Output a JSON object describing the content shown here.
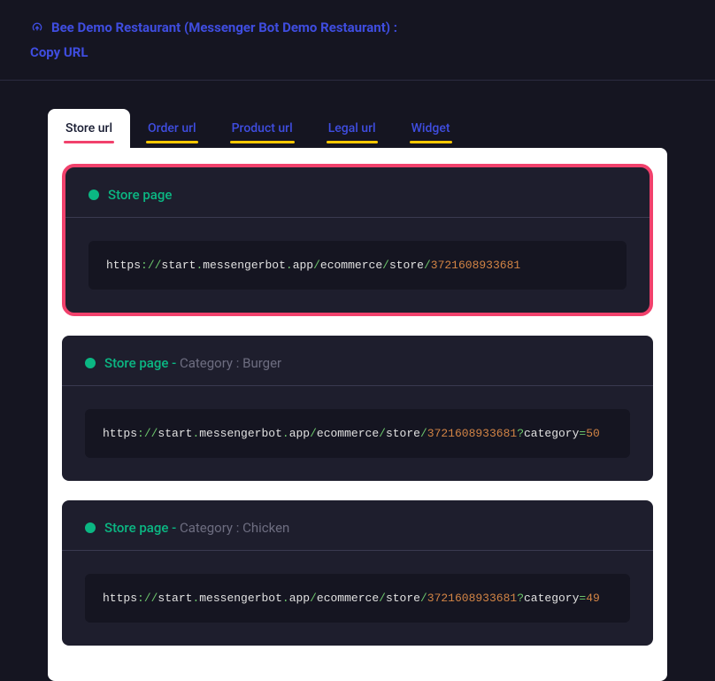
{
  "header": {
    "title": "Bee Demo Restaurant (Messenger Bot Demo Restaurant) :",
    "subtitle": "Copy URL"
  },
  "tabs": [
    {
      "label": "Store url",
      "active": true
    },
    {
      "label": "Order url",
      "active": false
    },
    {
      "label": "Product url",
      "active": false
    },
    {
      "label": "Legal url",
      "active": false
    },
    {
      "label": "Widget",
      "active": false
    }
  ],
  "cards": [
    {
      "highlighted": true,
      "title_main": "Store page",
      "title_sub": "",
      "url_tokens": [
        {
          "t": "https",
          "c": "white"
        },
        {
          "t": "://",
          "c": "green"
        },
        {
          "t": "start",
          "c": "white"
        },
        {
          "t": ".",
          "c": "green"
        },
        {
          "t": "messengerbot",
          "c": "white"
        },
        {
          "t": ".",
          "c": "green"
        },
        {
          "t": "app",
          "c": "white"
        },
        {
          "t": "/",
          "c": "green"
        },
        {
          "t": "ecommerce",
          "c": "white"
        },
        {
          "t": "/",
          "c": "green"
        },
        {
          "t": "store",
          "c": "white"
        },
        {
          "t": "/",
          "c": "green"
        },
        {
          "t": "3721608933681",
          "c": "orange"
        }
      ]
    },
    {
      "highlighted": false,
      "title_main": "Store page - ",
      "title_sub": "Category : Burger",
      "url_tokens": [
        {
          "t": "https",
          "c": "white"
        },
        {
          "t": "://",
          "c": "green"
        },
        {
          "t": "start",
          "c": "white"
        },
        {
          "t": ".",
          "c": "green"
        },
        {
          "t": "messengerbot",
          "c": "white"
        },
        {
          "t": ".",
          "c": "green"
        },
        {
          "t": "app",
          "c": "white"
        },
        {
          "t": "/",
          "c": "green"
        },
        {
          "t": "ecommerce",
          "c": "white"
        },
        {
          "t": "/",
          "c": "green"
        },
        {
          "t": "store",
          "c": "white"
        },
        {
          "t": "/",
          "c": "green"
        },
        {
          "t": "3721608933681",
          "c": "orange"
        },
        {
          "t": "?",
          "c": "green"
        },
        {
          "t": "category",
          "c": "white"
        },
        {
          "t": "=",
          "c": "green"
        },
        {
          "t": "50",
          "c": "orange"
        }
      ]
    },
    {
      "highlighted": false,
      "title_main": "Store page - ",
      "title_sub": "Category : Chicken",
      "url_tokens": [
        {
          "t": "https",
          "c": "white"
        },
        {
          "t": "://",
          "c": "green"
        },
        {
          "t": "start",
          "c": "white"
        },
        {
          "t": ".",
          "c": "green"
        },
        {
          "t": "messengerbot",
          "c": "white"
        },
        {
          "t": ".",
          "c": "green"
        },
        {
          "t": "app",
          "c": "white"
        },
        {
          "t": "/",
          "c": "green"
        },
        {
          "t": "ecommerce",
          "c": "white"
        },
        {
          "t": "/",
          "c": "green"
        },
        {
          "t": "store",
          "c": "white"
        },
        {
          "t": "/",
          "c": "green"
        },
        {
          "t": "3721608933681",
          "c": "orange"
        },
        {
          "t": "?",
          "c": "green"
        },
        {
          "t": "category",
          "c": "white"
        },
        {
          "t": "=",
          "c": "green"
        },
        {
          "t": "49",
          "c": "orange"
        }
      ]
    }
  ]
}
